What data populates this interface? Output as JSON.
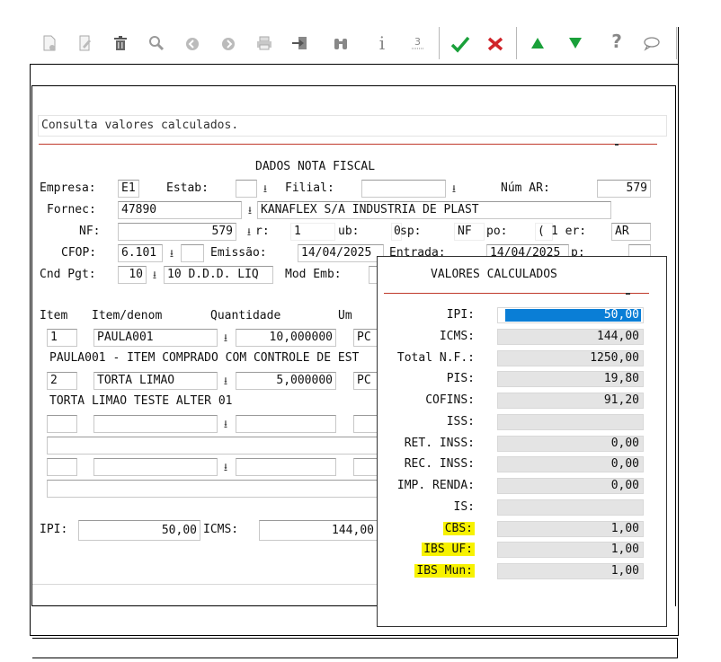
{
  "toolbar": {
    "icons": [
      "new-doc",
      "edit",
      "trash",
      "search",
      "prev",
      "next",
      "print",
      "export",
      "binoculars",
      "info",
      "numbering",
      "confirm",
      "cancel",
      "move-up",
      "move-down",
      "help",
      "comment"
    ],
    "info_glyph": "i",
    "help_glyph": "?"
  },
  "message": "Consulta valores calculados.",
  "form": {
    "section_title": "DADOS NOTA FISCAL",
    "empresa_label": "Empresa:",
    "empresa_value": "E1",
    "estab_label": "Estab:",
    "filial_label": "Filial:",
    "num_ar_label": "Núm AR:",
    "num_ar_value": "579",
    "fornec_label": "Fornec:",
    "fornec_code": "47890",
    "fornec_name": "KANAFLEX S/A INDUSTRIA DE PLAST",
    "nf_label": "NF:",
    "nf_value": "579",
    "ser_label": "r:",
    "ser_value": "1",
    "sub_label": "ub:",
    "sub_value": "0",
    "esp_label": "sp:",
    "esp_value": "NF",
    "tipo_label": "po:",
    "tipo_value": "(",
    "emitter_label": "1 er:",
    "emitter_value": "AR",
    "cfop_label": "CFOP:",
    "cfop_value": "6.101",
    "emissao_label": "Emissão:",
    "emissao_value": "14/04/2025",
    "entrada_label": "Entrada:",
    "entrada_value": "14/04/2025",
    "extra_label": "p:",
    "cnd_pgt_label": "Cnd Pgt:",
    "cnd_pgt_code": "10",
    "cnd_pgt_desc": "10 D.D.D. LIQ",
    "mod_emb_label": "Mod Emb:"
  },
  "items": {
    "headers": [
      "Item",
      "Item/denom",
      "Quantidade",
      "Um"
    ],
    "rows": [
      {
        "item": "1",
        "code": "PAULA001",
        "qty": "10,000000",
        "um": "PC",
        "desc": "PAULA001 - ITEM COMPRADO COM CONTROLE DE EST"
      },
      {
        "item": "2",
        "code": "TORTA LIMAO",
        "qty": "5,000000",
        "um": "PC",
        "desc": "TORTA LIMAO TESTE ALTER 01"
      }
    ]
  },
  "totals": {
    "ipi_label": "IPI:",
    "ipi_value": "50,00",
    "icms_label": "ICMS:",
    "icms_value": "144,00"
  },
  "popup": {
    "title": "VALORES CALCULADOS",
    "rows": [
      {
        "label": "IPI:",
        "value": "50,00",
        "highlight": false,
        "selected": true
      },
      {
        "label": "ICMS:",
        "value": "144,00",
        "highlight": false,
        "selected": false
      },
      {
        "label": "Total N.F.:",
        "value": "1250,00",
        "highlight": false,
        "selected": false
      },
      {
        "label": "PIS:",
        "value": "19,80",
        "highlight": false,
        "selected": false
      },
      {
        "label": "COFINS:",
        "value": "91,20",
        "highlight": false,
        "selected": false
      },
      {
        "label": "ISS:",
        "value": "",
        "highlight": false,
        "selected": false
      },
      {
        "label": "RET. INSS:",
        "value": "0,00",
        "highlight": false,
        "selected": false
      },
      {
        "label": "REC. INSS:",
        "value": "0,00",
        "highlight": false,
        "selected": false
      },
      {
        "label": "IMP. RENDA:",
        "value": "0,00",
        "highlight": false,
        "selected": false
      },
      {
        "label": "IS:",
        "value": "",
        "highlight": false,
        "selected": false
      },
      {
        "label": "CBS:",
        "value": "1,00",
        "highlight": true,
        "selected": false
      },
      {
        "label": "IBS UF:",
        "value": "1,00",
        "highlight": true,
        "selected": false
      },
      {
        "label": "IBS Mun:",
        "value": "1,00",
        "highlight": true,
        "selected": false
      }
    ]
  },
  "colors": {
    "highlight": "#f7f200",
    "selection": "#0a7ed6",
    "rule_red": "#c0392b",
    "accept_green": "#1aa03a",
    "cancel_red": "#d0242a"
  }
}
